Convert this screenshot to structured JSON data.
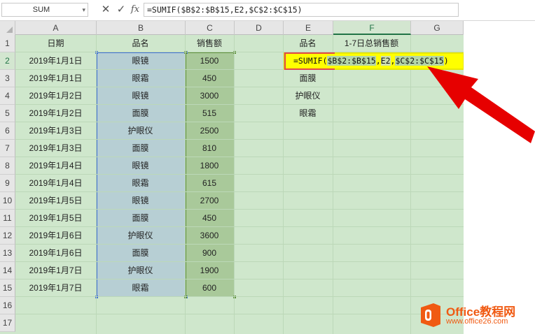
{
  "formula_bar": {
    "name_box": "SUM",
    "cancel_icon": "close-icon",
    "enter_icon": "check-icon",
    "fx_label": "fx",
    "formula": "=SUMIF($B$2:$B$15,E2,$C$2:$C$15)"
  },
  "columns": [
    "A",
    "B",
    "C",
    "D",
    "E",
    "F",
    "G"
  ],
  "rows": [
    "1",
    "2",
    "3",
    "4",
    "5",
    "6",
    "7",
    "8",
    "9",
    "10",
    "11",
    "12",
    "13",
    "14",
    "15",
    "16",
    "17"
  ],
  "headers": {
    "A": "日期",
    "B": "品名",
    "C": "销售额",
    "E": "品名",
    "F": "1-7日总销售额"
  },
  "data_rows": [
    {
      "date": "2019年1月1日",
      "product": "眼镜",
      "sales": "1500"
    },
    {
      "date": "2019年1月1日",
      "product": "眼霜",
      "sales": "450"
    },
    {
      "date": "2019年1月2日",
      "product": "眼镜",
      "sales": "3000"
    },
    {
      "date": "2019年1月2日",
      "product": "面膜",
      "sales": "515"
    },
    {
      "date": "2019年1月3日",
      "product": "护眼仪",
      "sales": "2500"
    },
    {
      "date": "2019年1月3日",
      "product": "面膜",
      "sales": "810"
    },
    {
      "date": "2019年1月4日",
      "product": "眼镜",
      "sales": "1800"
    },
    {
      "date": "2019年1月4日",
      "product": "眼霜",
      "sales": "615"
    },
    {
      "date": "2019年1月5日",
      "product": "眼镜",
      "sales": "2700"
    },
    {
      "date": "2019年1月5日",
      "product": "面膜",
      "sales": "450"
    },
    {
      "date": "2019年1月6日",
      "product": "护眼仪",
      "sales": "3600"
    },
    {
      "date": "2019年1月6日",
      "product": "面膜",
      "sales": "900"
    },
    {
      "date": "2019年1月7日",
      "product": "护眼仪",
      "sales": "1900"
    },
    {
      "date": "2019年1月7日",
      "product": "眼霜",
      "sales": "600"
    }
  ],
  "lookup_products": [
    "面膜",
    "护眼仪",
    "眼霜"
  ],
  "edit_cell": {
    "prefix": "=SUMIF(",
    "arg1": "$B$2:$B$15",
    "sep1": ",",
    "arg2": "E2",
    "sep2": ",",
    "arg3": "$C$2:$C$15",
    "suffix": ")"
  },
  "watermark": {
    "line1": "Office教程网",
    "line2": "www.office26.com"
  },
  "colors": {
    "sheet_bg": "#cfe7cc",
    "edit_highlight": "#ffff00",
    "arrow": "#e60000",
    "accent": "#217346",
    "logo": "#f05a12"
  }
}
